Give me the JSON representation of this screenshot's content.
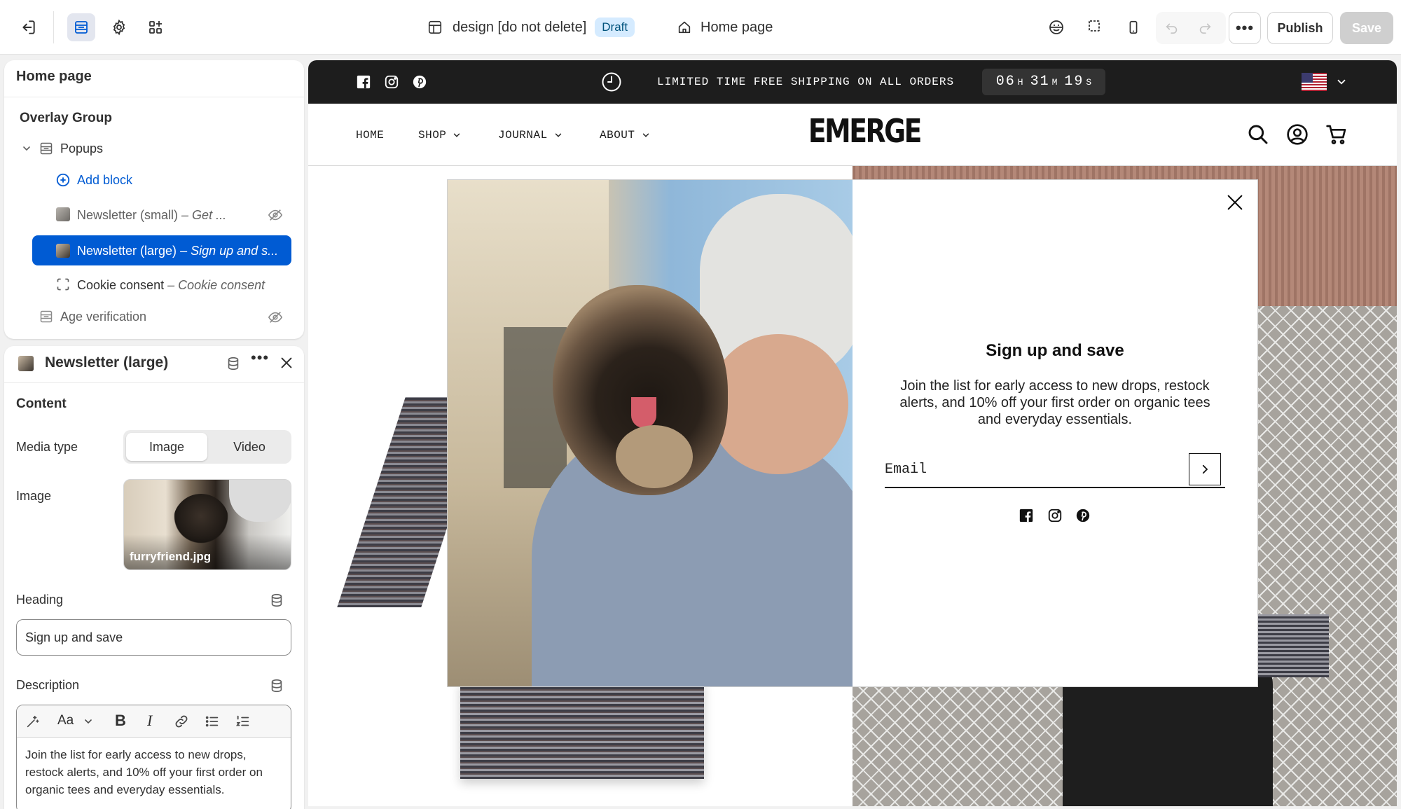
{
  "topbar": {
    "theme_name": "design [do not delete]",
    "theme_status": "Draft",
    "page_name": "Home page",
    "publish_label": "Publish",
    "save_label": "Save"
  },
  "sidebar": {
    "page_title": "Home page",
    "group_title": "Overlay Group",
    "popups_label": "Popups",
    "add_block_label": "Add block",
    "items": [
      {
        "name": "Newsletter (small)",
        "detail": "– Get ...",
        "hidden": true
      },
      {
        "name": "Newsletter (large)",
        "detail": "– Sign up and s...",
        "selected": true
      },
      {
        "name": "Cookie consent",
        "detail": "– Cookie consent"
      }
    ],
    "age_verification_label": "Age verification"
  },
  "settings": {
    "block_title": "Newsletter (large)",
    "section_title": "Content",
    "media_type_label": "Media type",
    "media_options": [
      "Image",
      "Video"
    ],
    "media_selected": "Image",
    "image_label": "Image",
    "image_filename": "furryfriend.jpg",
    "heading_label": "Heading",
    "heading_value": "Sign up and save",
    "description_label": "Description",
    "description_value": "Join the list for early access to new drops, restock alerts, and 10% off your first order on organic tees and everyday essentials."
  },
  "store": {
    "announcement": "LIMITED TIME FREE SHIPPING ON ALL ORDERS",
    "countdown": {
      "h": "06",
      "m": "31",
      "s": "19",
      "h_unit": "H",
      "m_unit": "M",
      "s_unit": "S"
    },
    "nav": [
      "HOME",
      "SHOP",
      "JOURNAL",
      "ABOUT"
    ],
    "logo": "EMERGE",
    "popup": {
      "heading": "Sign up and save",
      "body": "Join the list for early access to new drops, restock alerts, and 10% off your first order on organic tees and everyday essentials.",
      "email_placeholder": "Email"
    }
  },
  "colors": {
    "accent": "#005bd3",
    "draft_bg": "#d5ebff",
    "announcement_bg": "#1d1d1d"
  }
}
